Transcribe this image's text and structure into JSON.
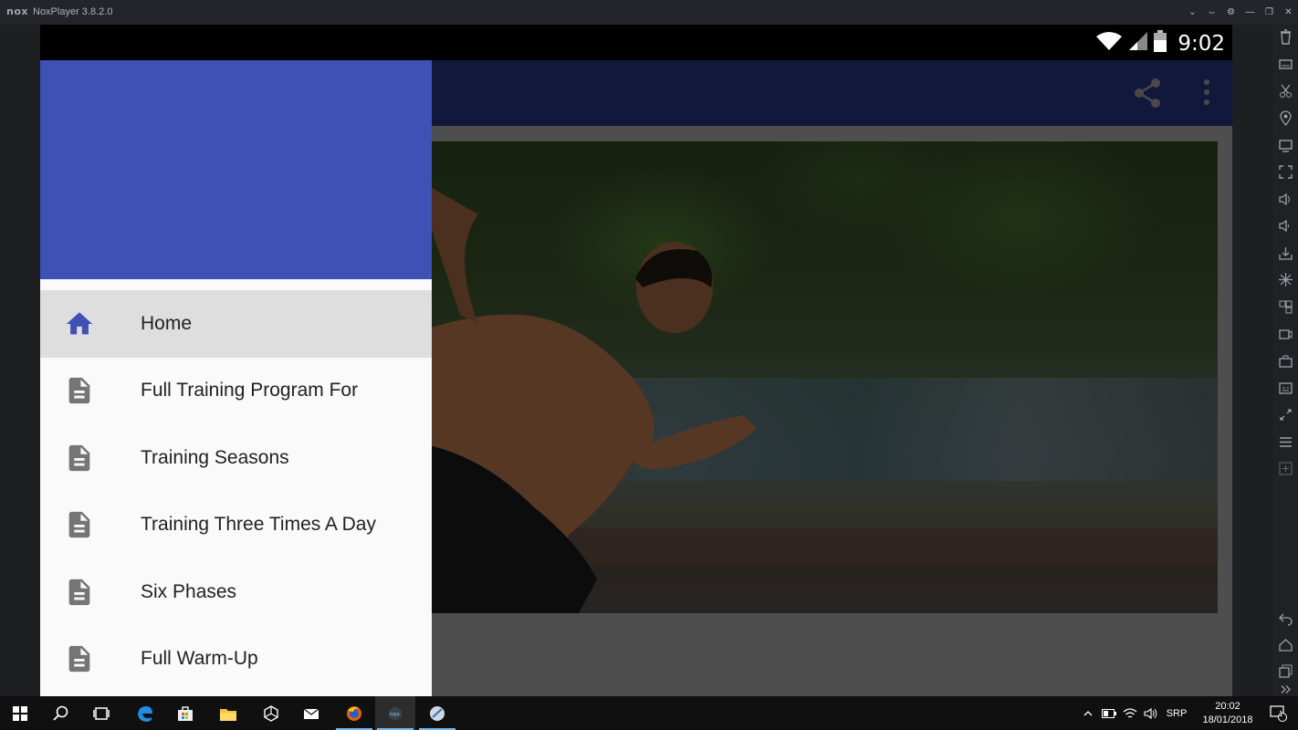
{
  "window": {
    "logo": "nox",
    "title": "NoxPlayer 3.8.2.0",
    "controls": [
      "chevron-down-icon",
      "restore-icon",
      "gear-icon",
      "minimize-icon",
      "maximize-icon",
      "close-icon"
    ]
  },
  "android": {
    "status": {
      "time": "9:02"
    },
    "appbar": {
      "actions": [
        "share-icon",
        "more-vert-icon"
      ]
    },
    "drawer": {
      "header_color": "#3f51b5",
      "items": [
        {
          "label": "Home",
          "icon": "home-icon",
          "active": true
        },
        {
          "label": "Full Training Program For",
          "icon": "document-icon",
          "active": false
        },
        {
          "label": "Training Seasons",
          "icon": "document-icon",
          "active": false
        },
        {
          "label": "Training Three Times A Day",
          "icon": "document-icon",
          "active": false
        },
        {
          "label": "Six Phases",
          "icon": "document-icon",
          "active": false
        },
        {
          "label": "Full Warm-Up",
          "icon": "document-icon",
          "active": false
        }
      ]
    }
  },
  "sidebar_tools": [
    "trash-icon",
    "keyboard-icon",
    "scissors-icon",
    "location-icon",
    "screen-icon",
    "fullscreen-icon",
    "volume-up-icon",
    "volume-down-icon",
    "install-apk-icon",
    "shake-icon",
    "multi-instance-icon",
    "record-icon",
    "toolbox-icon",
    "macro-icon",
    "sync-icon",
    "menu-icon",
    "add-icon",
    "back-icon",
    "home-icon",
    "recents-icon",
    "expand-icon"
  ],
  "taskbar": {
    "apps": [
      "windows-start-icon",
      "search-icon",
      "task-view-icon",
      "edge-icon",
      "store-icon",
      "file-explorer-icon",
      "unity-icon",
      "mail-icon",
      "firefox-icon",
      "nox-icon",
      "app-icon"
    ],
    "language": "SRP",
    "time": "20:02",
    "date": "18/01/2018",
    "notifications": "1"
  },
  "colors": {
    "accent": "#3f51b5",
    "appbar": "#1d2760",
    "taskbar": "#101010",
    "drawer_bg": "#fafafa",
    "active_item": "#dedede"
  }
}
